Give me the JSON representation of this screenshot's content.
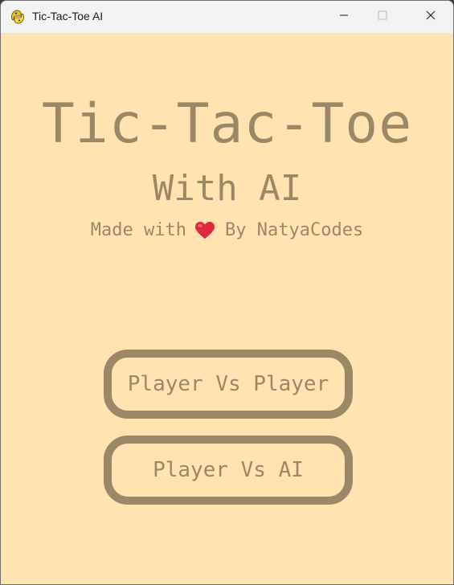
{
  "window": {
    "title": "Tic-Tac-Toe AI",
    "icon": "python-snake-icon",
    "controls": [
      "minimize-icon",
      "maximize-icon",
      "close-icon"
    ]
  },
  "menu": {
    "title": "Tic-Tac-Toe",
    "subtitle": "With AI",
    "credit_prefix": "Made with",
    "credit_icon": "heart-icon",
    "credit_suffix": "By NatyaCodes",
    "buttons": {
      "pvp": "Player Vs Player",
      "pva": "Player Vs AI"
    }
  },
  "colors": {
    "background": "#ffe3b0",
    "text": "#9b8866",
    "heart": "#e0283a",
    "titlebar": "#f3f3f3"
  }
}
